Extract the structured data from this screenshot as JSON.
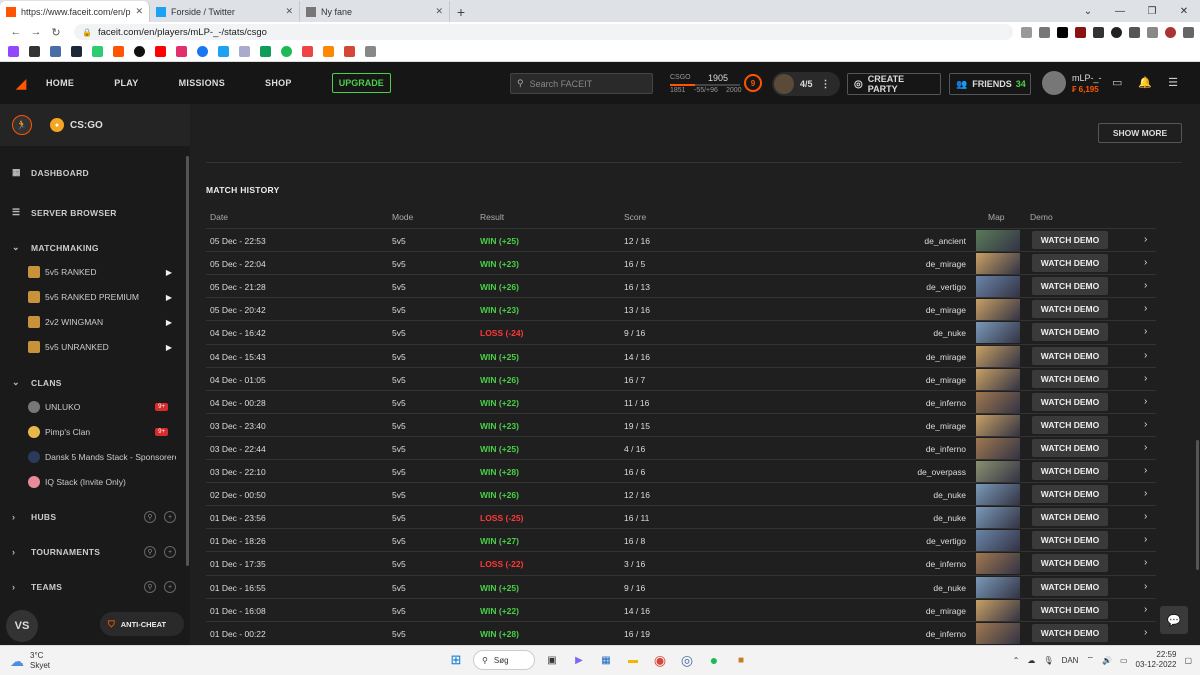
{
  "browser": {
    "tabs": [
      {
        "title": "https://www.faceit.com/en/player",
        "active": true,
        "color": "#ff5500"
      },
      {
        "title": "Forside / Twitter",
        "active": false,
        "color": "#1da1f2"
      },
      {
        "title": "Ny fane",
        "active": false,
        "color": "#777777"
      }
    ],
    "new_tab": "+",
    "url": "faceit.com/en/players/mLP-_-/stats/csgo"
  },
  "header": {
    "nav": [
      "HOME",
      "PLAY",
      "MISSIONS",
      "SHOP"
    ],
    "upgrade": "UPGRADE",
    "search_placeholder": "Search FACEIT",
    "elo": {
      "game": "CSGO",
      "value": "1905",
      "low": "1851",
      "diff": "-55/+96",
      "high": "2000",
      "level": "9",
      "progress_fraction": 0.36
    },
    "party_count": "4/5",
    "create_party": "CREATE PARTY",
    "friends_label": "FRIENDS",
    "friends_count": "34",
    "username": "mLP-_-",
    "points": "6,195"
  },
  "sidebar": {
    "game": "CS:GO",
    "dashboard": "DASHBOARD",
    "server_browser": "SERVER BROWSER",
    "matchmaking": "MATCHMAKING",
    "queues": [
      "5v5 RANKED",
      "5v5 RANKED PREMIUM",
      "2v2 WINGMAN",
      "5v5 UNRANKED"
    ],
    "clans_label": "CLANS",
    "clans": [
      {
        "name": "UNLUKO",
        "badge": "9+"
      },
      {
        "name": "Pimp's Clan",
        "badge": "9+"
      },
      {
        "name": "Dansk 5 Mands Stack - Sponsoreret af",
        "badge": ""
      },
      {
        "name": "IQ Stack (Invite Only)",
        "badge": ""
      }
    ],
    "hubs": "HUBS",
    "tournaments": "TOURNAMENTS",
    "teams": "TEAMS",
    "vs": "VS",
    "anticheat": "ANTI-CHEAT"
  },
  "main": {
    "show_more": "SHOW MORE",
    "title": "MATCH HISTORY",
    "columns": [
      "Date",
      "Mode",
      "Result",
      "Score",
      "Map",
      "Demo"
    ],
    "watch_label": "WATCH DEMO",
    "matches": [
      {
        "date": "05 Dec - 22:53",
        "mode": "5v5",
        "result": "WIN (+25)",
        "win": true,
        "score": "12 / 16",
        "map": "de_ancient"
      },
      {
        "date": "05 Dec - 22:04",
        "mode": "5v5",
        "result": "WIN (+23)",
        "win": true,
        "score": "16 / 5",
        "map": "de_mirage"
      },
      {
        "date": "05 Dec - 21:28",
        "mode": "5v5",
        "result": "WIN (+26)",
        "win": true,
        "score": "16 / 13",
        "map": "de_vertigo"
      },
      {
        "date": "05 Dec - 20:42",
        "mode": "5v5",
        "result": "WIN (+23)",
        "win": true,
        "score": "13 / 16",
        "map": "de_mirage"
      },
      {
        "date": "04 Dec - 16:42",
        "mode": "5v5",
        "result": "LOSS (-24)",
        "win": false,
        "score": "9 / 16",
        "map": "de_nuke"
      },
      {
        "date": "04 Dec - 15:43",
        "mode": "5v5",
        "result": "WIN (+25)",
        "win": true,
        "score": "14 / 16",
        "map": "de_mirage"
      },
      {
        "date": "04 Dec - 01:05",
        "mode": "5v5",
        "result": "WIN (+26)",
        "win": true,
        "score": "16 / 7",
        "map": "de_mirage"
      },
      {
        "date": "04 Dec - 00:28",
        "mode": "5v5",
        "result": "WIN (+22)",
        "win": true,
        "score": "11 / 16",
        "map": "de_inferno"
      },
      {
        "date": "03 Dec - 23:40",
        "mode": "5v5",
        "result": "WIN (+23)",
        "win": true,
        "score": "19 / 15",
        "map": "de_mirage"
      },
      {
        "date": "03 Dec - 22:44",
        "mode": "5v5",
        "result": "WIN (+25)",
        "win": true,
        "score": "4 / 16",
        "map": "de_inferno"
      },
      {
        "date": "03 Dec - 22:10",
        "mode": "5v5",
        "result": "WIN (+28)",
        "win": true,
        "score": "16 / 6",
        "map": "de_overpass"
      },
      {
        "date": "02 Dec - 00:50",
        "mode": "5v5",
        "result": "WIN (+26)",
        "win": true,
        "score": "12 / 16",
        "map": "de_nuke"
      },
      {
        "date": "01 Dec - 23:56",
        "mode": "5v5",
        "result": "LOSS (-25)",
        "win": false,
        "score": "16 / 11",
        "map": "de_nuke"
      },
      {
        "date": "01 Dec - 18:26",
        "mode": "5v5",
        "result": "WIN (+27)",
        "win": true,
        "score": "16 / 8",
        "map": "de_vertigo"
      },
      {
        "date": "01 Dec - 17:35",
        "mode": "5v5",
        "result": "LOSS (-22)",
        "win": false,
        "score": "3 / 16",
        "map": "de_inferno"
      },
      {
        "date": "01 Dec - 16:55",
        "mode": "5v5",
        "result": "WIN (+25)",
        "win": true,
        "score": "9 / 16",
        "map": "de_nuke"
      },
      {
        "date": "01 Dec - 16:08",
        "mode": "5v5",
        "result": "WIN (+22)",
        "win": true,
        "score": "14 / 16",
        "map": "de_mirage"
      },
      {
        "date": "01 Dec - 00:22",
        "mode": "5v5",
        "result": "WIN (+28)",
        "win": true,
        "score": "16 / 19",
        "map": "de_inferno"
      }
    ]
  },
  "taskbar": {
    "temp": "3°C",
    "weather": "Skyet",
    "search": "Søg",
    "lang": "DAN",
    "time": "22:59",
    "date": "03-12-2022"
  },
  "colors": {
    "accent": "#ff5500",
    "win": "#4ccf49",
    "loss": "#ff3838"
  }
}
